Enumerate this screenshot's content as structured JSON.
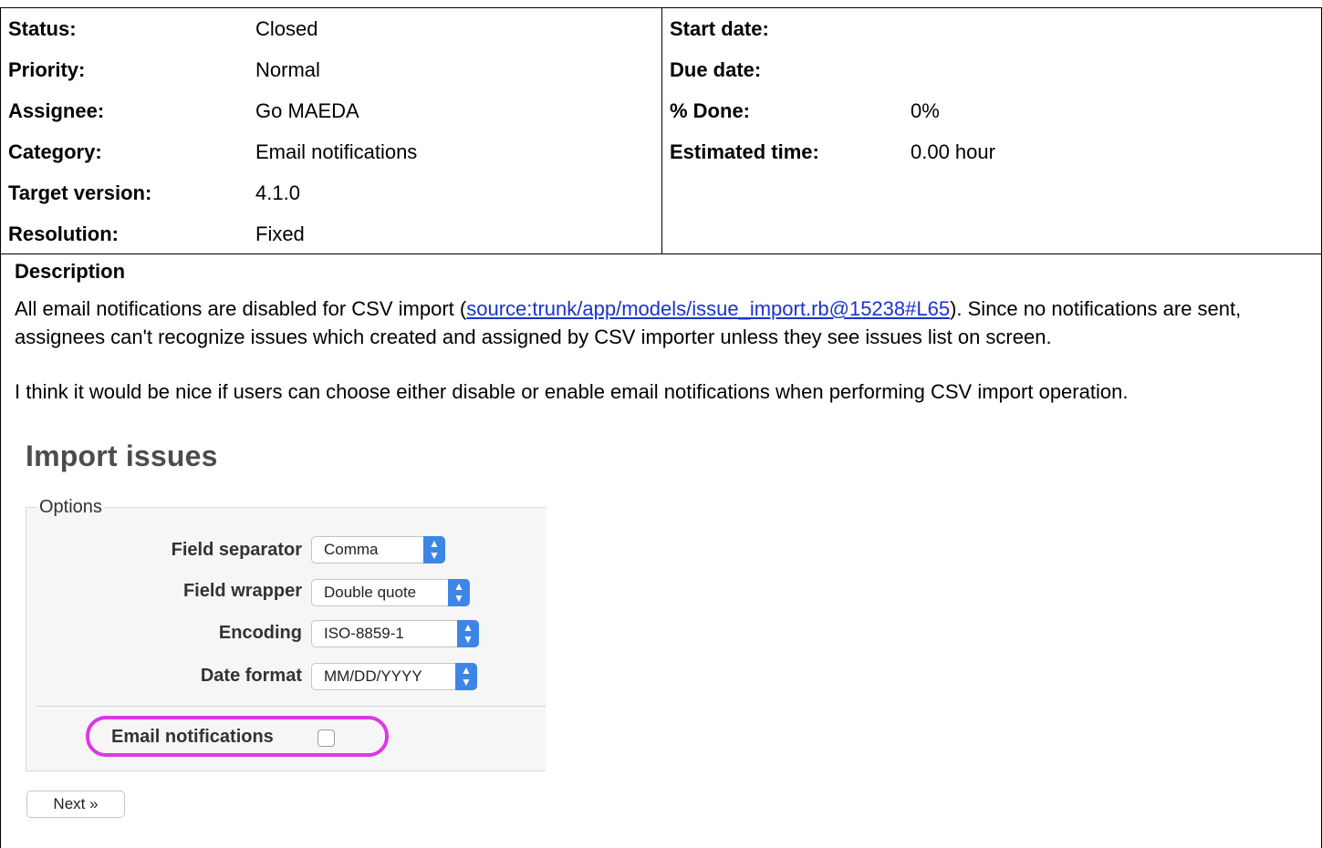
{
  "issue": {
    "left": [
      {
        "label": "Status:",
        "value": "Closed"
      },
      {
        "label": "Priority:",
        "value": "Normal"
      },
      {
        "label": "Assignee:",
        "value": "Go MAEDA"
      },
      {
        "label": "Category:",
        "value": "Email notifications"
      },
      {
        "label": "Target version:",
        "value": "4.1.0"
      },
      {
        "label": "Resolution:",
        "value": "Fixed"
      }
    ],
    "right": [
      {
        "label": "Start date:",
        "value": ""
      },
      {
        "label": "Due date:",
        "value": ""
      },
      {
        "label": "% Done:",
        "value": "0%"
      },
      {
        "label": "Estimated time:",
        "value": "0.00 hour"
      }
    ]
  },
  "description": {
    "title": "Description",
    "para1_before": "All email notifications are disabled for CSV import (",
    "para1_link": "source:trunk/app/models/issue_import.rb@15238#L65",
    "para1_after": "). Since no notifications are sent, assignees can't recognize issues which created and assigned by CSV importer unless they see issues list on screen.",
    "para2": "I think it would be nice if users can choose either disable or enable email notifications when performing CSV import operation."
  },
  "import_screenshot": {
    "title": "Import issues",
    "legend": "Options",
    "fields": [
      {
        "label": "Field separator",
        "value": "Comma"
      },
      {
        "label": "Field wrapper",
        "value": "Double quote"
      },
      {
        "label": "Encoding",
        "value": "ISO-8859-1"
      },
      {
        "label": "Date format",
        "value": "MM/DD/YYYY"
      }
    ],
    "email_label": "Email notifications",
    "email_checked": false,
    "next_label": "Next »",
    "highlight_color": "#dc37e6",
    "select_accent": "#3d86e6"
  }
}
